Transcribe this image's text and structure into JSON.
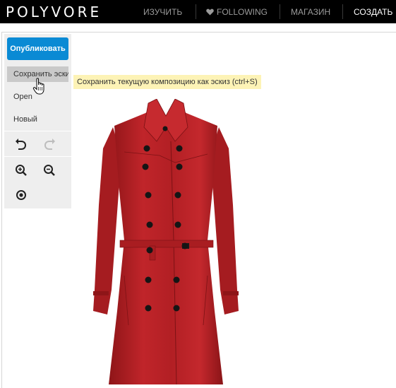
{
  "header": {
    "logo": "POLYVORE",
    "nav": [
      {
        "label": "ИЗУЧИТЬ",
        "icon": null
      },
      {
        "label": "FOLLOWING",
        "icon": "heart-icon"
      },
      {
        "label": "МАГАЗИН",
        "icon": null
      },
      {
        "label": "СОЗДАТЬ",
        "icon": null
      }
    ]
  },
  "sidebar": {
    "publish_label": "Опубликовать",
    "items": [
      {
        "label": "Сохранить эскиз"
      },
      {
        "label": "Open"
      },
      {
        "label": "Новый"
      }
    ],
    "tools": [
      "undo-icon",
      "redo-icon",
      "zoom-in-icon",
      "zoom-out-icon",
      "center-icon"
    ]
  },
  "tooltip": {
    "text": "Сохранить текущую композицию как эскиз (ctrl+S)"
  },
  "colors": {
    "publish": "#0a8ad4",
    "coat": "#b51e22",
    "tooltip": "#fdf3b6"
  }
}
